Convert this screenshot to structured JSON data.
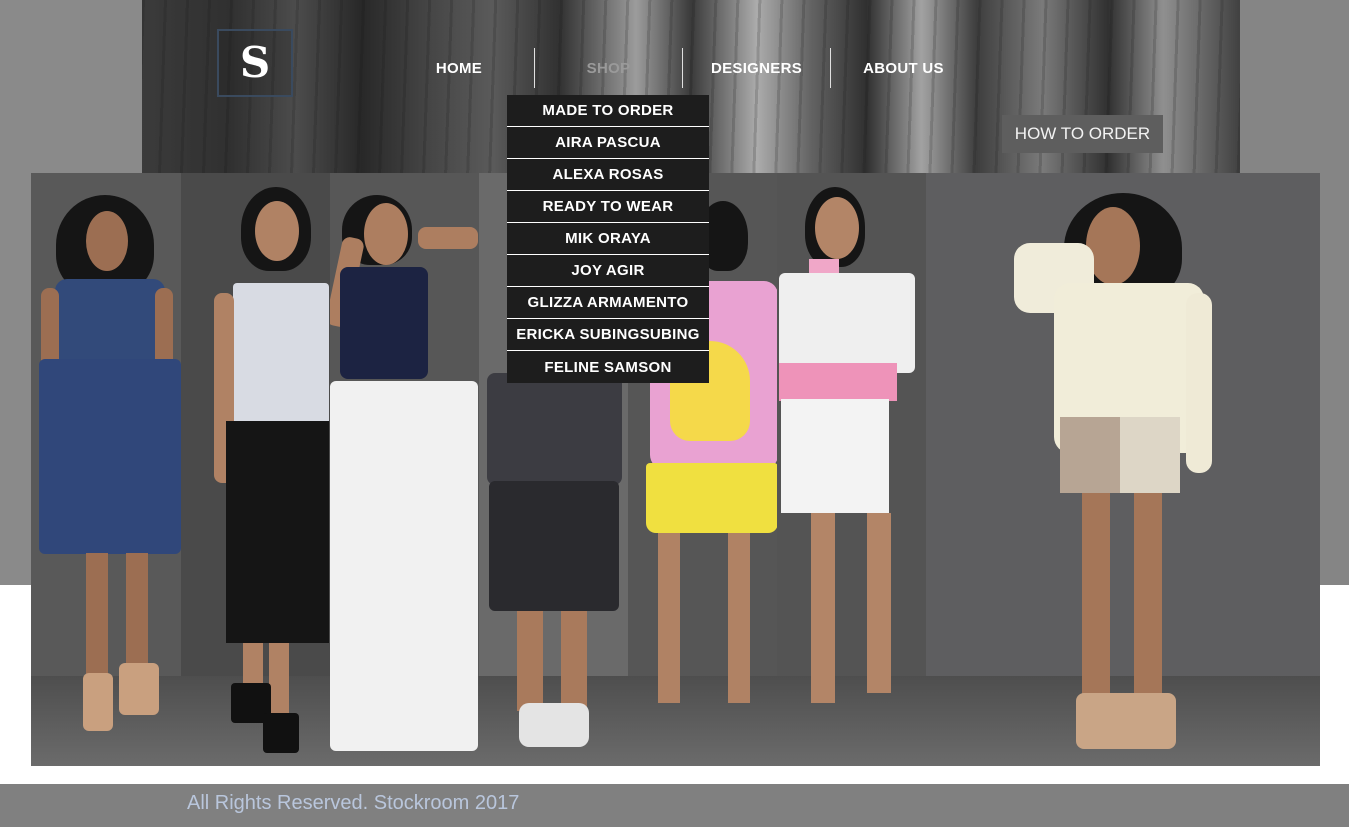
{
  "logo": {
    "letter": "S"
  },
  "nav": {
    "items": [
      {
        "label": "HOME",
        "active": false
      },
      {
        "label": "SHOP",
        "active": true
      },
      {
        "label": "DESIGNERS",
        "active": false
      },
      {
        "label": "ABOUT US",
        "active": false
      }
    ]
  },
  "shop_menu": {
    "items": [
      "MADE TO ORDER",
      "AIRA PASCUA",
      "ALEXA ROSAS",
      "READY TO WEAR",
      "MIK ORAYA",
      "JOY AGIR",
      "GLIZZA ARMAMENTO",
      "ERICKA SUBINGSUBING",
      "FELINE SAMSON"
    ]
  },
  "how_to_order": {
    "label": "HOW TO ORDER"
  },
  "footer": {
    "text": "All Rights Reserved. Stockroom 2017"
  },
  "colors": {
    "nav_text": "#ffffff",
    "nav_active": "#9a9a9a",
    "dropdown_bg": "#1d1d1d",
    "footer_bg": "#808080",
    "footer_text": "#b9c6dc",
    "button_bg": "#5e5e5e"
  }
}
